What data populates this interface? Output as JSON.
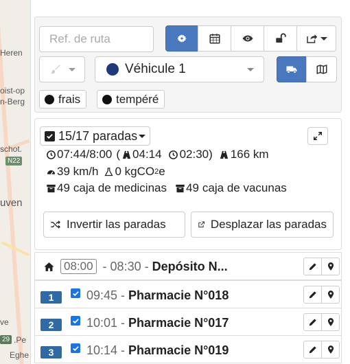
{
  "map": {
    "labels": [
      "Heren",
      "oist-op",
      "n-Berg",
      "schot.",
      "uven",
      "ve",
      ".Pe",
      "Eghe"
    ],
    "badge": "N22",
    "badge2": "29"
  },
  "toolbar": {
    "route_ref_placeholder": "Ref. de ruta",
    "vehicle_label": "Véhicule 1",
    "vehicle_color": "#1f3a7a",
    "accent": "#4a78bf"
  },
  "tags": [
    {
      "label": "frais"
    },
    {
      "label": "tempéré"
    }
  ],
  "stats": {
    "stops_label": "15/17 paradas",
    "time_range": "07:44/8:00",
    "drive_time": "04:14",
    "wait_time": "02:30",
    "distance": "166 km",
    "speed": "39 km/h",
    "co2": "0 kgCO",
    "co2_sub": "2",
    "co2_suffix": "e",
    "quantity1": "49",
    "unit1": "caja de medicinas",
    "quantity2": "49",
    "unit2": "caja de vacunas",
    "open_paren": "(",
    "close_paren": ")"
  },
  "actions": {
    "invert": "Invertir las paradas",
    "move": "Desplazar las paradas"
  },
  "stops": [
    {
      "index": "",
      "time_start": "08:00",
      "time_end": "08:30",
      "name": "Depósito N...",
      "depot": true,
      "checked": false
    },
    {
      "index": "1",
      "time": "09:45",
      "name": "Pharmacie N°018",
      "depot": false,
      "checked": true
    },
    {
      "index": "2",
      "time": "10:01",
      "name": "Pharmacie N°017",
      "depot": false,
      "checked": true
    },
    {
      "index": "3",
      "time": "10:14",
      "name": "Pharmacie N°019",
      "depot": false,
      "checked": true
    }
  ],
  "sep": "-"
}
